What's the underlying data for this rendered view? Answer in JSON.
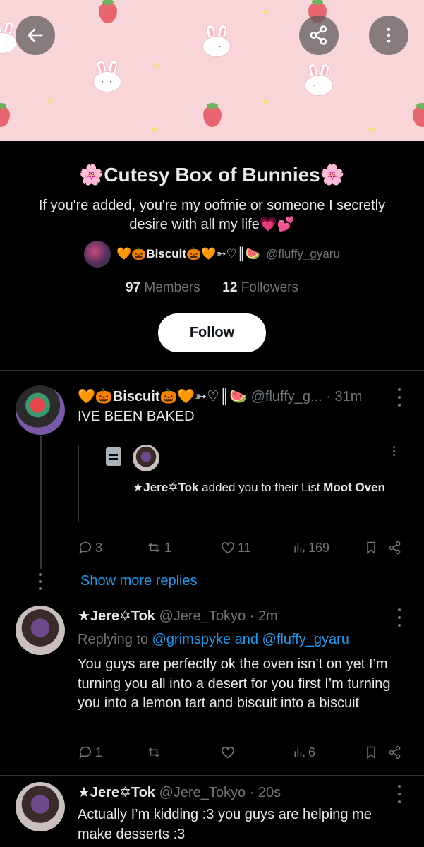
{
  "list": {
    "title": "🌸Cutesy Box of Bunnies🌸",
    "description": "If you're added, you're my oofmie or someone I secretly desire with all my life💗💕",
    "owner_name": "🧡🎃Biscuit🎃🧡➳♡║🍉",
    "owner_handle": "@fluffy_gyaru",
    "members_count": "97",
    "members_label": "Members",
    "followers_count": "12",
    "followers_label": "Followers",
    "follow_label": "Follow"
  },
  "toolbar": {
    "back_icon": "arrow-left-icon",
    "share_icon": "share-icon",
    "more_icon": "more-vertical-icon"
  },
  "tweets": [
    {
      "name": "🧡🎃Biscuit🎃🧡➳♡║🍉",
      "handle": "@fluffy_g...",
      "time": "· 31m",
      "text": "IVE BEEN BAKED",
      "quote": {
        "actor": "★Jere✡︎Tok",
        "action": " added you to their List ",
        "list_name": "Moot Oven"
      },
      "replies": "3",
      "reposts": "1",
      "likes": "11",
      "views": "169"
    },
    {
      "name": "★Jere✡︎Tok",
      "handle": "@Jere_Tokyo",
      "time": "· 2m",
      "replying_prefix": "Replying to ",
      "replying_users": "@grimspyke and @fluffy_gyaru",
      "text": "You guys are perfectly ok the oven isn’t on yet I’m turning you all into a desert for you first I’m turning you into a lemon tart and biscuit into a biscuit",
      "replies": "1",
      "reposts": "",
      "likes": "",
      "views": "6"
    },
    {
      "name": "★Jere✡︎Tok",
      "handle": "@Jere_Tokyo",
      "time": "· 20s",
      "text": "Actually I’m kidding :3 you guys are helping me make desserts :3"
    }
  ],
  "show_more_replies": "Show more replies",
  "colors": {
    "background": "#000000",
    "text": "#e7e9ea",
    "secondary": "#71767b",
    "link": "#1d9bf0",
    "banner": "#f7d5d8"
  }
}
